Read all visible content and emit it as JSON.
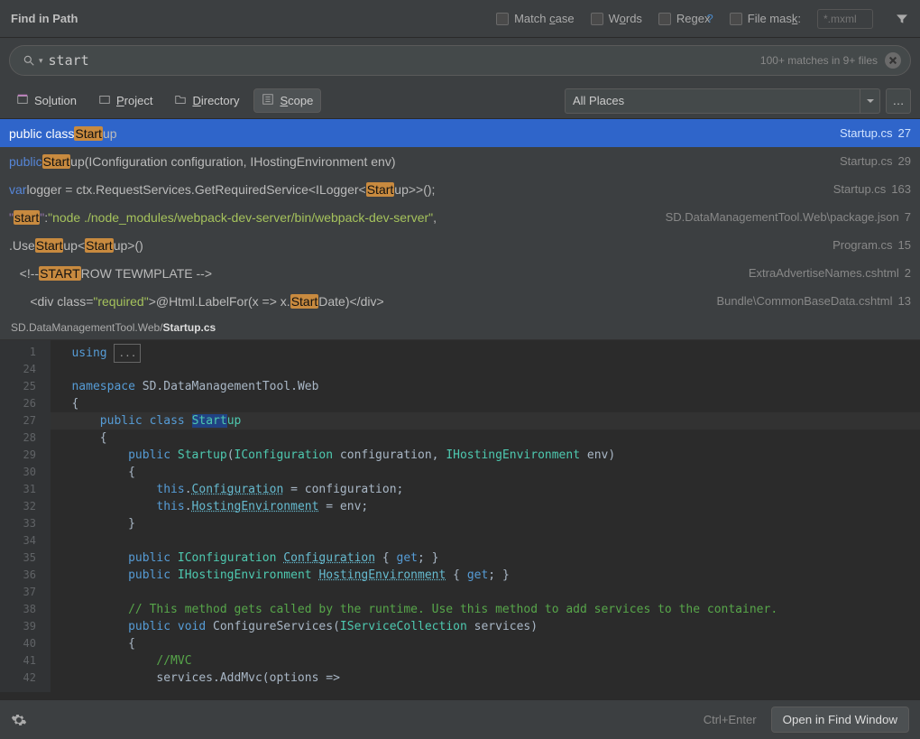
{
  "title": "Find in Path",
  "options": {
    "matchcase_html": "Match <span class='mnemonic'>c</span>ase",
    "words_html": "W<span class='mnemonic'>o</span>rds",
    "regex_html": "Re<span class='mnemonic'>g</span>ex",
    "filemask_html": "File mas<span class='mnemonic'>k</span>:",
    "filemask_placeholder": "*.mxml"
  },
  "search": {
    "query": "start",
    "matches_info": "100+ matches in 9+ files"
  },
  "scope_tabs": [
    {
      "name": "solution",
      "label_html": "So<span class='mnemonic'>l</span>ution"
    },
    {
      "name": "project",
      "label_html": "<span class='mnemonic'>P</span>roject"
    },
    {
      "name": "directory",
      "label_html": "<span class='mnemonic'>D</span>irectory"
    },
    {
      "name": "scope",
      "label_html": "<span class='mnemonic'>S</span>cope",
      "active": true
    }
  ],
  "places_selected": "All Places",
  "results": [
    {
      "selected": true,
      "html": "<span class='kw'>public class </span><span class='hl'>Start</span>up",
      "file": "Startup.cs",
      "line": "27"
    },
    {
      "html": "<span class='kw'>public </span><span class='hl'>Start</span>up(IConfiguration configuration, IHostingEnvironment env)",
      "file": "Startup.cs",
      "line": "29"
    },
    {
      "html": "<span class='kw'>var </span>logger = ctx.RequestServices.GetRequiredService&lt;ILogger&lt;<span class='hl'>Start</span>up&gt;&gt;();",
      "file": "Startup.cs",
      "line": "163"
    },
    {
      "html": "<span class='prop'>\"</span><span class='hl'>start</span><span class='prop'>\"</span>: <span class='string'>\"node ./node_modules/webpack-dev-server/bin/webpack-dev-server\"</span>,",
      "file": "SD.DataManagementTool.Web\\package.json",
      "line": "7"
    },
    {
      "html": ".Use<span class='hl'>Start</span>up&lt;<span class='hl'>Start</span>up&gt;()",
      "file": "Program.cs",
      "line": "15"
    },
    {
      "html": "&nbsp;&nbsp;&nbsp;&lt;!-- <span class='hl'>START</span> ROW TEWMPLATE --&gt;",
      "file": "ExtraAdvertiseNames.cshtml",
      "line": "2"
    },
    {
      "html": "&nbsp;&nbsp;&nbsp;&nbsp;&nbsp;&nbsp;&lt;div class=<span class='string'>\"required\"</span>&gt;@Html.LabelFor(x =&gt; x.<span class='hl'>Start</span>Date)&lt;/div&gt;",
      "file": "Bundle\\CommonBaseData.cshtml",
      "line": "13"
    }
  ],
  "preview": {
    "path_prefix": "SD.DataManagementTool.Web/",
    "filename": "Startup.cs",
    "gutter": [
      "1",
      "24",
      "25",
      "26",
      "27",
      "28",
      "29",
      "30",
      "31",
      "32",
      "33",
      "34",
      "35",
      "36",
      "37",
      "38",
      "39",
      "40",
      "41",
      "42"
    ],
    "lines": [
      {
        "html": "   <span class='c-kw'>using</span> <span class='fold-box'>...</span>"
      },
      {
        "html": ""
      },
      {
        "html": "   <span class='c-kw'>namespace</span> SD.DataManagementTool.Web"
      },
      {
        "html": "   {"
      },
      {
        "hl": true,
        "html": "       <span class='c-kw'>public</span> <span class='c-kw'>class</span> <span class='c-sel c-type'>Start</span><span class='c-type'>up</span>"
      },
      {
        "html": "       {"
      },
      {
        "html": "           <span class='c-kw'>public</span> <span class='c-type'>Startup</span>(<span class='c-type'>IConfiguration</span> configuration, <span class='c-type'>IHostingEnvironment</span> env)"
      },
      {
        "html": "           {"
      },
      {
        "html": "               <span class='c-kw'>this</span>.<span class='c-prop'>Configuration</span> = configuration;"
      },
      {
        "html": "               <span class='c-kw'>this</span>.<span class='c-prop'>HostingEnvironment</span> = env;"
      },
      {
        "html": "           }"
      },
      {
        "html": ""
      },
      {
        "html": "           <span class='c-kw'>public</span> <span class='c-type'>IConfiguration</span> <span class='c-prop'>Configuration</span> { <span class='c-kw'>get</span>; }"
      },
      {
        "html": "           <span class='c-kw'>public</span> <span class='c-type'>IHostingEnvironment</span> <span class='c-prop'>HostingEnvironment</span> { <span class='c-kw'>get</span>; }"
      },
      {
        "html": ""
      },
      {
        "html": "           <span class='c-comment'>// This method gets called by the runtime. Use this method to add services to the container.</span>"
      },
      {
        "html": "           <span class='c-kw'>public</span> <span class='c-kw'>void</span> ConfigureServices(<span class='c-type'>IServiceCollection</span> services)"
      },
      {
        "html": "           {"
      },
      {
        "html": "               <span class='c-comment'>//MVC</span>"
      },
      {
        "html": "               services.AddMvc(options =&gt;"
      }
    ]
  },
  "bottom": {
    "shortcut": "Ctrl+Enter",
    "open_button": "Open in Find Window"
  }
}
